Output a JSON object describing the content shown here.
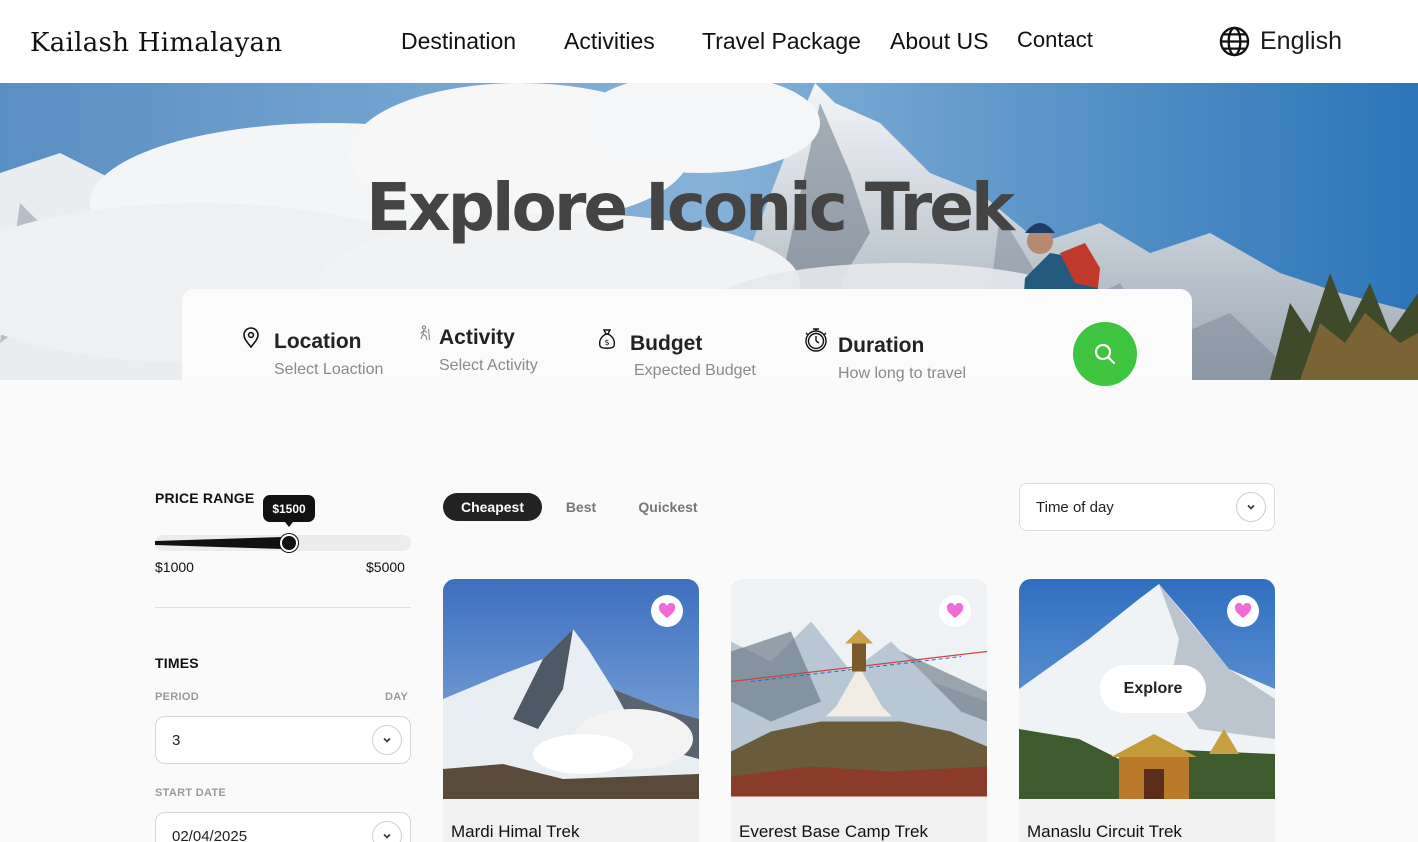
{
  "brand": "Kailash Himalayan",
  "nav": {
    "destination": "Destination",
    "activities": "Activities",
    "travel_package": "Travel Package",
    "about": "About US",
    "contact": "Contact"
  },
  "language": {
    "label": "English",
    "icon": "globe-icon"
  },
  "hero": {
    "title": "Explore Iconic Trek"
  },
  "search": {
    "location": {
      "label": "Location",
      "placeholder": "Select Loaction",
      "icon": "map-pin-icon"
    },
    "activity": {
      "label": "Activity",
      "placeholder": "Select Activity",
      "icon": "hiker-icon"
    },
    "budget": {
      "label": "Budget",
      "placeholder": "Expected Budget",
      "icon": "money-bag-icon"
    },
    "duration": {
      "label": "Duration",
      "placeholder": "How long to travel",
      "icon": "stopwatch-icon"
    },
    "button_icon": "search-icon",
    "accent": "#3ec43e"
  },
  "filters": {
    "price_range": {
      "title": "PRICE RANGE",
      "min_label": "$1000",
      "max_label": "$5000",
      "current_label": "$1500",
      "min": 1000,
      "max": 5000,
      "current": 1500
    },
    "times": {
      "title": "TIMES",
      "period_label": "PERIOD",
      "day_label": "DAY",
      "period_value": "3",
      "start_date_label": "START DATE",
      "start_date_value": "02/04/2025"
    }
  },
  "sort": {
    "tabs": [
      "Cheapest",
      "Best",
      "Quickest"
    ],
    "active": "Cheapest",
    "time_of_day": "Time of day"
  },
  "treks": [
    {
      "name": "Mardi Himal Trek",
      "favorited": true
    },
    {
      "name": "Everest Base Camp Trek",
      "favorited": true
    },
    {
      "name": "Manaslu Circuit Trek",
      "favorited": true,
      "hover_action": "Explore"
    }
  ],
  "colors": {
    "heart": "#f06ad8",
    "tab_active": "#222222"
  }
}
